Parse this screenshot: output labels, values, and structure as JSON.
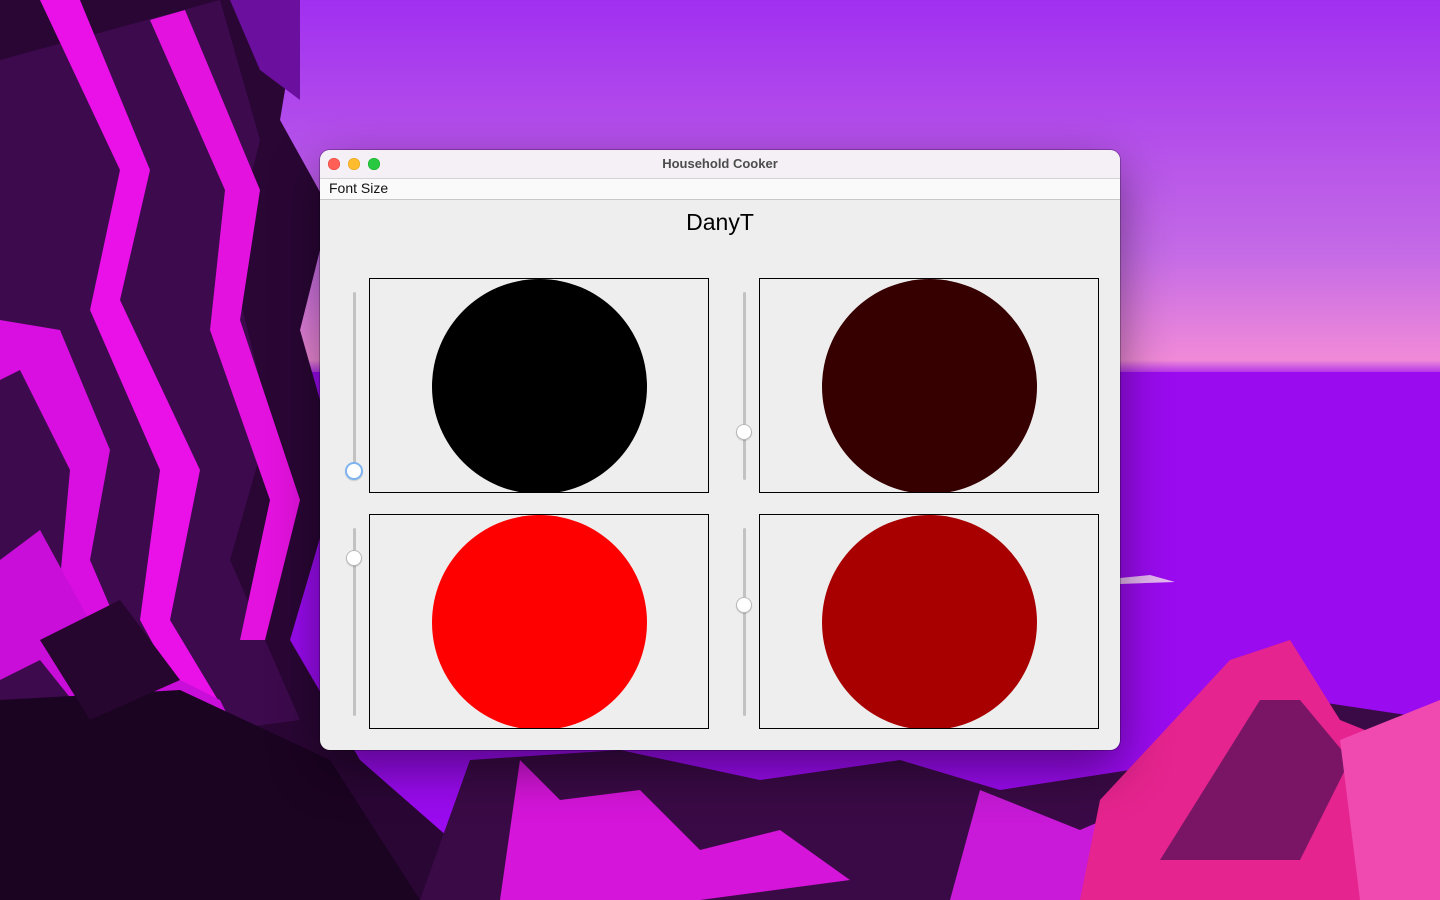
{
  "window": {
    "title": "Household Cooker",
    "menu": {
      "font_size_label": "Font Size"
    },
    "heading": "DanyT"
  },
  "panels": [
    {
      "id": "top-left",
      "circle_color": "#000000",
      "slider_value_pct": 0,
      "slider_focused": true
    },
    {
      "id": "top-right",
      "circle_color": "#360000",
      "slider_value_pct": 23
    },
    {
      "id": "bottom-left",
      "circle_color": "#ff0000",
      "slider_value_pct": 87
    },
    {
      "id": "bottom-right",
      "circle_color": "#a80000",
      "slider_value_pct": 60
    }
  ],
  "colors": {
    "close": "#fe5f57",
    "minimize": "#febc2e",
    "maximize": "#28c840"
  }
}
